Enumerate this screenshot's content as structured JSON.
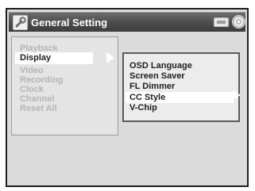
{
  "window": {
    "title": "General Setting",
    "left_icon": "wrench-icon",
    "right_icons": [
      "tv-icon",
      "disc-icon"
    ]
  },
  "main_menu": {
    "items": [
      {
        "label": "Playback",
        "selected": false
      },
      {
        "label": "Display",
        "selected": true
      },
      {
        "label": "Video",
        "selected": false
      },
      {
        "label": "Recording",
        "selected": false
      },
      {
        "label": "Clock",
        "selected": false
      },
      {
        "label": "Channel",
        "selected": false
      },
      {
        "label": "Reset All",
        "selected": false
      }
    ]
  },
  "submenu": {
    "items": [
      {
        "label": "OSD Language",
        "selected": false
      },
      {
        "label": "Screen Saver",
        "selected": false
      },
      {
        "label": "FL Dimmer",
        "selected": false
      },
      {
        "label": "CC Style",
        "selected": true
      },
      {
        "label": "V-Chip",
        "selected": false
      }
    ]
  },
  "colors": {
    "frame_bg": "#dbdbdb",
    "titlebar": "#4b4b4b",
    "highlight": "#ffffff",
    "inactive_text": "#b5b5b5",
    "active_text": "#1e1e1e"
  }
}
